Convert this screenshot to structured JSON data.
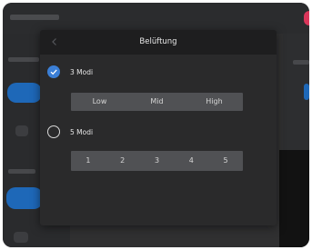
{
  "dialog": {
    "title": "Belüftung",
    "back_icon": "chevron-left-icon"
  },
  "options": [
    {
      "label": "3 Modi",
      "selected": true,
      "modes": [
        "Low",
        "Mid",
        "High"
      ]
    },
    {
      "label": "5 Modi",
      "selected": false,
      "modes": [
        "1",
        "2",
        "3",
        "4",
        "5"
      ]
    }
  ],
  "colors": {
    "accent": "#3b7fd6",
    "dialog_bg": "#2a2a2b",
    "header_bg": "#1e1e1f",
    "segment_bg": "#505154"
  }
}
